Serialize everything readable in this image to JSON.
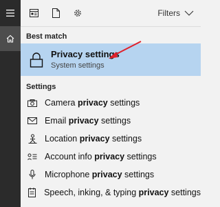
{
  "toolbar": {
    "filters_label": "Filters"
  },
  "best_match": {
    "header": "Best match",
    "title": "Privacy settings",
    "subtitle": "System settings"
  },
  "settings": {
    "header": "Settings",
    "items": [
      {
        "pre": "Camera ",
        "bold": "privacy",
        "post": " settings",
        "icon": "camera-icon"
      },
      {
        "pre": "Email ",
        "bold": "privacy",
        "post": " settings",
        "icon": "envelope-icon"
      },
      {
        "pre": "Location ",
        "bold": "privacy",
        "post": " settings",
        "icon": "location-person-icon"
      },
      {
        "pre": "Account info ",
        "bold": "privacy",
        "post": " settings",
        "icon": "account-info-icon"
      },
      {
        "pre": "Microphone ",
        "bold": "privacy",
        "post": " settings",
        "icon": "microphone-icon"
      },
      {
        "pre": "Speech, inking, & typing ",
        "bold": "privacy",
        "post": " settings",
        "icon": "notepad-icon"
      }
    ]
  },
  "colors": {
    "highlight": "#b6d4f0",
    "arrow": "#e0202a",
    "rail": "#2b2b2b"
  }
}
